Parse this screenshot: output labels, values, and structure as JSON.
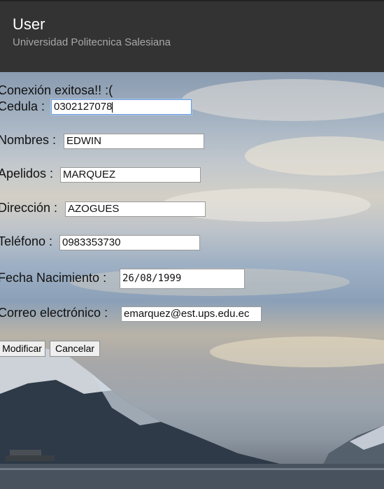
{
  "header": {
    "title": "User",
    "subtitle": "Universidad Politecnica Salesiana"
  },
  "status_message": "Conexión exitosa!! :(",
  "form": {
    "cedula": {
      "label": "Cedula :",
      "value": "0302127078"
    },
    "nombres": {
      "label": "Nombres :",
      "value": "EDWIN"
    },
    "apellidos": {
      "label": "Apelidos :",
      "value": "MARQUEZ"
    },
    "direccion": {
      "label": "Dirección :",
      "value": "AZOGUES"
    },
    "telefono": {
      "label": "Teléfono :",
      "value": "0983353730"
    },
    "fecha": {
      "label": "Fecha Nacimiento :",
      "value": "26/08/1999"
    },
    "correo": {
      "label": "Correo electrónico :",
      "value": "emarquez@est.ups.edu.ec"
    }
  },
  "buttons": {
    "modificar": "Modificar",
    "cancelar": "Cancelar"
  },
  "colors": {
    "header_bg": "#333333",
    "header_title": "#ffffff",
    "header_subtitle": "#a8a8a8"
  }
}
